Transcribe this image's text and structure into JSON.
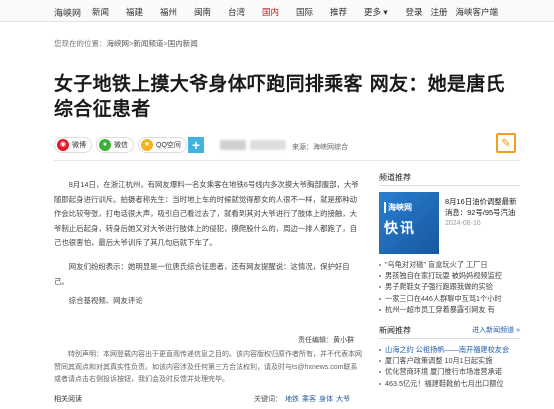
{
  "topnav": {
    "logo": "海峡网",
    "items": [
      "新闻",
      "福建",
      "福州",
      "闽南",
      "台湾",
      "国内",
      "国际",
      "推荐",
      "更多 ▾"
    ],
    "active_index": 5,
    "login": "登录",
    "register": "注册",
    "client": "海峡客户端"
  },
  "breadcrumb": {
    "prefix": "您现在的位置：",
    "s1": "海峡网",
    "s2": "新闻频道",
    "s3": "国内新闻"
  },
  "article": {
    "title": "女子地铁上摸大爷身体吓跑同排乘客 网友：她是唐氏综合征患者",
    "share": {
      "weibo": "微博",
      "wechat": "微信",
      "qzone": "QQ空间",
      "plus": "+"
    },
    "source_label": "来源：",
    "source": "海峡网综合",
    "paragraphs": [
      "8月14日，在浙江杭州，有网友爆料一名女乘客在地铁6号线内多次摸大爷胸部腹部，大爷随即起身进行训斥。拍摄者称先生：当时地上车的时候就觉得那女的人很不一样，那个时候她的跟乘客聊天，她没有什么劲头，也有点吓人的样子，她也摸我的大爷了我也没说什么，然后大爷就说她，她就起来了就不说话了，她就开始叫，她就开始叫，摸我的时候那个大爷就站起来骂她，然后她就走了，附近的也有很多人也看起来，她大爷看了看就说她有点问题，她起来走了离开。",
      "网友们纷纷表示：她明显是一位唐氏综合征患者，还有网友提醒说：这情况，保护好自己。",
      "综合基视频、网友评论"
    ],
    "p1": "8月14日，在浙江杭州，有网友爆料一名女乘客在地铁6号线内多次摸大爷胸部腹部，大爷随即起身进行训斥。拍摄者称先生：当时地上车的时候就觉得那女的人很不一样，就是那种动作会比较夸张，打电话很大声，吸引自己看过去了，就看到其对大爷进行了肢体上的接触，大爷制止后起身，转身后她又对大爷进行肢体上的侵犯，摸爬股什么的，周边一排人都跑了，自己也很害怕，最后大爷训斥了其几句后就下车了。",
    "p2": "网友们纷纷表示：她明显是一位唐氏综合征患者，还有网友提醒说：这情况，保护好自己。",
    "p3": "综合基视频、网友评论",
    "editor": "责任编辑：黄小群",
    "disclaimer": "特别声明：本网登载内容出于更直观传递信息之目的。该内容版权归原作者所有，并不代表本网赞同其观点和对其真实性负责。如该内容涉及任何第三方合法权利，请及时与ts@hxnews.com联系或者请点击右侧投诉按钮，我们会及时反馈并处理完毕。",
    "related_label": "相关阅读",
    "keywords_label": "关键词：",
    "keywords": [
      "地铁",
      "乘客",
      "身体",
      "大爷"
    ]
  },
  "sidebar": {
    "sec1_title": "频道推荐",
    "feature": {
      "img_label1": "海峡网",
      "img_label2": "快讯",
      "text": "8月16日油价调整最新消息：92号/95号汽油",
      "date": "2024-08-16"
    },
    "items": [
      "\"乌龟对对碰\" 盲盒玩火了 工厂日",
      "男孩独自在家打玩耍 被妈妈视频监控",
      "男子爬鞋女子强行跑跟我做的实验",
      "一家三口在446人群聊中互骂1个小时",
      "杭州一超市员工穿着暴露引网友 有"
    ],
    "sec2_title": "新闻推荐",
    "sec2_more": "进入新闻频道 »",
    "sec2_items": [
      "山海之约 公祖扬帆——南开福建校友会",
      "厦门客户政策调整 10月1日起实施",
      "优化营商环境 厦门推行市场准营承诺",
      "463.5亿元！福建鞋靴前七月出口额位"
    ],
    "sec2_item_prefix": "2"
  }
}
